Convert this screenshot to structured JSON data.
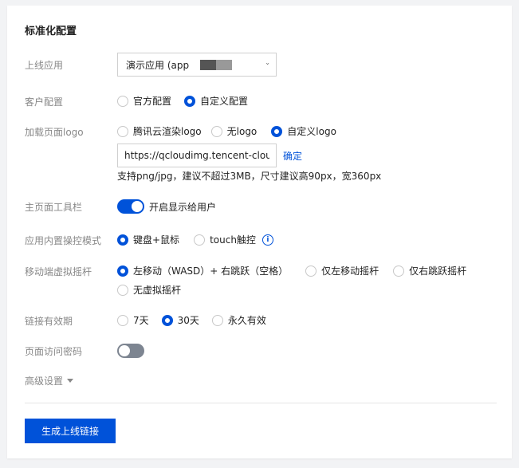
{
  "section_title": "标准化配置",
  "online_app": {
    "label": "上线应用",
    "selected": "演示应用 (app"
  },
  "client_config": {
    "label": "客户配置",
    "options": [
      "官方配置",
      "自定义配置"
    ],
    "selected_index": 1
  },
  "loading_logo": {
    "label": "加载页面logo",
    "options": [
      "腾讯云渲染logo",
      "无logo",
      "自定义logo"
    ],
    "selected_index": 2,
    "url_value": "https://qcloudimg.tencent-cloud.c",
    "confirm_label": "确定",
    "hint": "支持png/jpg，建议不超过3MB，尺寸建议高90px，宽360px"
  },
  "toolbar": {
    "label": "主页面工具栏",
    "toggle_on": true,
    "toggle_text": "开启显示给用户"
  },
  "control_mode": {
    "label": "应用内置操控模式",
    "options": [
      "键盘+鼠标",
      "touch触控"
    ],
    "selected_index": 0
  },
  "virtual_joystick": {
    "label": "移动端虚拟摇杆",
    "options": [
      "左移动（WASD）+ 右跳跃（空格）",
      "仅左移动摇杆",
      "仅右跳跃摇杆",
      "无虚拟摇杆"
    ],
    "selected_index": 0
  },
  "link_validity": {
    "label": "链接有效期",
    "options": [
      "7天",
      "30天",
      "永久有效"
    ],
    "selected_index": 1
  },
  "password": {
    "label": "页面访问密码",
    "toggle_on": false
  },
  "advanced": {
    "label": "高级设置"
  },
  "generate_button": "生成上线链接",
  "colors": {
    "primary": "#0052d9",
    "toggle_off": "#7d8591",
    "label_gray": "#888888"
  }
}
